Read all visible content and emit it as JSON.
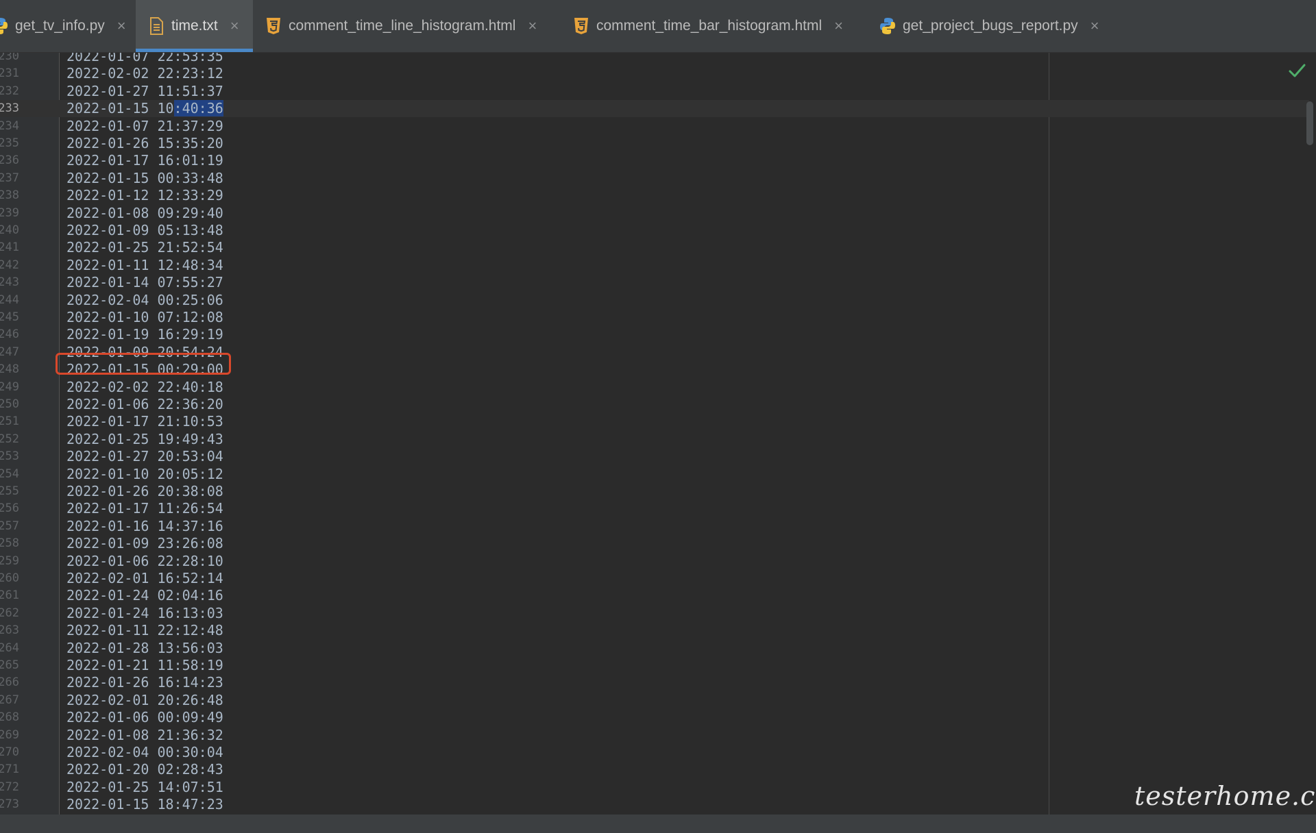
{
  "tabs": [
    {
      "label": "get_tv_info.py",
      "icon": "python-icon",
      "active": false
    },
    {
      "label": "time.txt",
      "icon": "text-file-icon",
      "active": true
    },
    {
      "label": "comment_time_line_histogram.html",
      "icon": "html5-icon",
      "active": false
    },
    {
      "label": "comment_time_bar_histogram.html",
      "icon": "html5-icon",
      "active": false
    },
    {
      "label": "get_project_bugs_report.py",
      "icon": "python-icon",
      "active": false
    }
  ],
  "close_glyph": "×",
  "editor": {
    "current_line": "233",
    "highlighted_line": "248",
    "lines": [
      {
        "n": "230",
        "t": "2022-01-07 22:53:35"
      },
      {
        "n": "231",
        "t": "2022-02-02 22:23:12"
      },
      {
        "n": "232",
        "t": "2022-01-27 11:51:37"
      },
      {
        "n": "233",
        "t": "2022-01-15 10:40:36"
      },
      {
        "n": "234",
        "t": "2022-01-07 21:37:29"
      },
      {
        "n": "235",
        "t": "2022-01-26 15:35:20"
      },
      {
        "n": "236",
        "t": "2022-01-17 16:01:19"
      },
      {
        "n": "237",
        "t": "2022-01-15 00:33:48"
      },
      {
        "n": "238",
        "t": "2022-01-12 12:33:29"
      },
      {
        "n": "239",
        "t": "2022-01-08 09:29:40"
      },
      {
        "n": "240",
        "t": "2022-01-09 05:13:48"
      },
      {
        "n": "241",
        "t": "2022-01-25 21:52:54"
      },
      {
        "n": "242",
        "t": "2022-01-11 12:48:34"
      },
      {
        "n": "243",
        "t": "2022-01-14 07:55:27"
      },
      {
        "n": "244",
        "t": "2022-02-04 00:25:06"
      },
      {
        "n": "245",
        "t": "2022-01-10 07:12:08"
      },
      {
        "n": "246",
        "t": "2022-01-19 16:29:19"
      },
      {
        "n": "247",
        "t": "2022-01-09 20:54:24"
      },
      {
        "n": "248",
        "t": "2022-01-15 00:29:00"
      },
      {
        "n": "249",
        "t": "2022-02-02 22:40:18"
      },
      {
        "n": "250",
        "t": "2022-01-06 22:36:20"
      },
      {
        "n": "251",
        "t": "2022-01-17 21:10:53"
      },
      {
        "n": "252",
        "t": "2022-01-25 19:49:43"
      },
      {
        "n": "253",
        "t": "2022-01-27 20:53:04"
      },
      {
        "n": "254",
        "t": "2022-01-10 20:05:12"
      },
      {
        "n": "255",
        "t": "2022-01-26 20:38:08"
      },
      {
        "n": "256",
        "t": "2022-01-17 11:26:54"
      },
      {
        "n": "257",
        "t": "2022-01-16 14:37:16"
      },
      {
        "n": "258",
        "t": "2022-01-09 23:26:08"
      },
      {
        "n": "259",
        "t": "2022-01-06 22:28:10"
      },
      {
        "n": "260",
        "t": "2022-02-01 16:52:14"
      },
      {
        "n": "261",
        "t": "2022-01-24 02:04:16"
      },
      {
        "n": "262",
        "t": "2022-01-24 16:13:03"
      },
      {
        "n": "263",
        "t": "2022-01-11 22:12:48"
      },
      {
        "n": "264",
        "t": "2022-01-28 13:56:03"
      },
      {
        "n": "265",
        "t": "2022-01-21 11:58:19"
      },
      {
        "n": "266",
        "t": "2022-01-26 16:14:23"
      },
      {
        "n": "267",
        "t": "2022-02-01 20:26:48"
      },
      {
        "n": "268",
        "t": "2022-01-06 00:09:49"
      },
      {
        "n": "269",
        "t": "2022-01-08 21:36:32"
      },
      {
        "n": "270",
        "t": "2022-02-04 00:30:04"
      },
      {
        "n": "271",
        "t": "2022-01-20 02:28:43"
      },
      {
        "n": "272",
        "t": "2022-01-25 14:07:51"
      },
      {
        "n": "273",
        "t": "2022-01-15 18:47:23"
      }
    ]
  },
  "status": {
    "inspection": "check-icon"
  },
  "watermark": "testerhome.com",
  "colors": {
    "highlight_box": "#d9482b",
    "selection": "#214283",
    "active_tab_underline": "#4a88c7"
  }
}
